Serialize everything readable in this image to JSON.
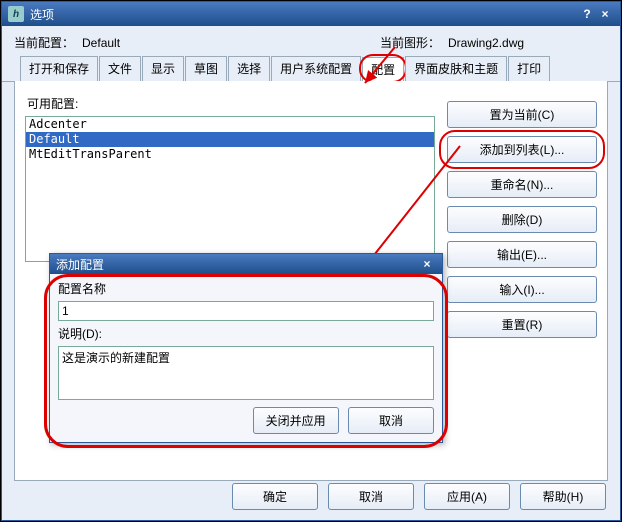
{
  "window": {
    "title": "选项",
    "help": "?",
    "close": "×",
    "logo_char": "h"
  },
  "toprow": {
    "cfg_label": "当前配置：",
    "cfg_value": "Default",
    "drw_label": "当前图形：",
    "drw_value": "Drawing2.dwg"
  },
  "tabs": {
    "t0": "打开和保存",
    "t1": "文件",
    "t2": "显示",
    "t3": "草图",
    "t4": "选择",
    "t5": "用户系统配置",
    "t6": "配置",
    "t7": "界面皮肤和主题",
    "t8": "打印"
  },
  "list": {
    "label": "可用配置:",
    "i0": "Adcenter",
    "i1": "Default",
    "i2": "MtEditTransParent"
  },
  "buttons": {
    "set_current": "置为当前(C)",
    "add_to_list": "添加到列表(L)...",
    "rename": "重命名(N)...",
    "delete": "删除(D)",
    "export": "输出(E)...",
    "import": "输入(I)...",
    "reset": "重置(R)"
  },
  "dlg": {
    "title": "添加配置",
    "close": "×",
    "name_label": "配置名称",
    "name_value": "1",
    "desc_label": "说明(D):",
    "desc_value": "这是演示的新建配置",
    "apply_close": "关闭并应用",
    "cancel": "取消"
  },
  "bottom": {
    "ok": "确定",
    "cancel": "取消",
    "apply": "应用(A)",
    "help": "帮助(H)"
  }
}
